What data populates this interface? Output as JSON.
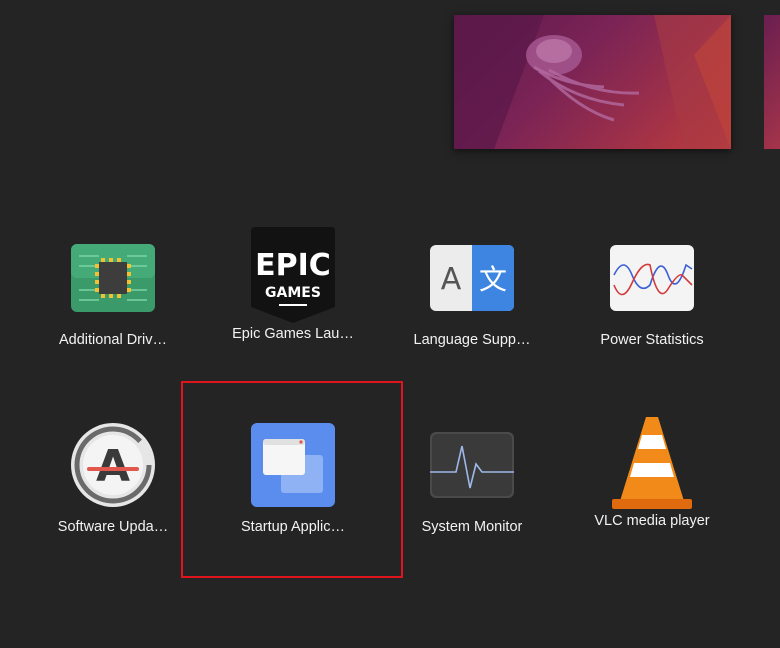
{
  "workspace": {
    "thumbnail": "ubuntu-jellyfish-wallpaper"
  },
  "apps": [
    {
      "label": "Additional Driv…",
      "icon": "chip-icon"
    },
    {
      "label": "Epic Games Lau…",
      "icon": "epic-games-icon",
      "icon_text_top": "EPIC",
      "icon_text_bottom": "GAMES"
    },
    {
      "label": "Language Supp…",
      "icon": "language-icon",
      "glyph_a": "A",
      "glyph_b": "文"
    },
    {
      "label": "Power Statistics",
      "icon": "power-statistics-icon"
    },
    {
      "label": "Software Upda…",
      "icon": "software-updater-icon",
      "glyph": "A"
    },
    {
      "label": "Startup Applic…",
      "icon": "startup-applications-icon"
    },
    {
      "label": "System Monitor",
      "icon": "system-monitor-icon"
    },
    {
      "label": "VLC media player",
      "icon": "vlc-icon"
    }
  ],
  "colors": {
    "background": "#242424",
    "highlight": "#e0141c"
  }
}
